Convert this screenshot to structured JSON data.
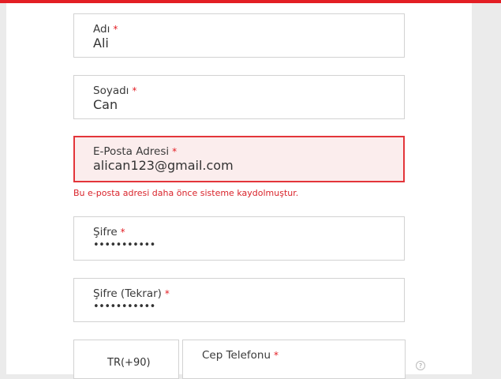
{
  "colors": {
    "accent": "#e31e24",
    "error_border": "#e3353a",
    "error_bg": "#fbeded",
    "error_text": "#d9232a"
  },
  "required_mark": "*",
  "fields": {
    "first_name": {
      "label": "Adı",
      "value": "Ali"
    },
    "last_name": {
      "label": "Soyadı",
      "value": "Can"
    },
    "email": {
      "label": "E-Posta Adresi",
      "value": "alican123@gmail.com",
      "error": "Bu e-posta adresi daha önce sisteme kaydolmuştur."
    },
    "password": {
      "label": "Şifre",
      "value": "•••••••••••"
    },
    "password_confirm": {
      "label": "Şifre (Tekrar)",
      "value": "•••••••••••"
    },
    "country_code": {
      "value": "TR(+90)"
    },
    "phone": {
      "label": "Cep Telefonu"
    }
  },
  "icons": {
    "help": "question-circle-icon"
  }
}
